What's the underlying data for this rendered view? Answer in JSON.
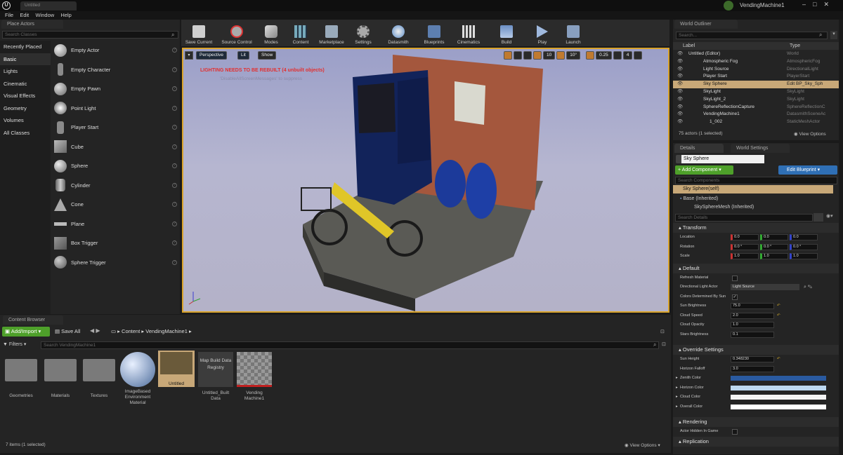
{
  "window": {
    "tab_title": "Untitled",
    "project_name": "VendingMachine1"
  },
  "menu": [
    "File",
    "Edit",
    "Window",
    "Help"
  ],
  "place_actors": {
    "tab": "Place Actors",
    "search_placeholder": "Search Classes",
    "categories": [
      "Recently Placed",
      "Basic",
      "Lights",
      "Cinematic",
      "Visual Effects",
      "Geometry",
      "Volumes",
      "All Classes"
    ],
    "selected_category": "Basic",
    "actors": [
      "Empty Actor",
      "Empty Character",
      "Empty Pawn",
      "Point Light",
      "Player Start",
      "Cube",
      "Sphere",
      "Cylinder",
      "Cone",
      "Plane",
      "Box Trigger",
      "Sphere Trigger"
    ]
  },
  "toolbar": [
    "Save Current",
    "Source Control",
    "Modes",
    "Content",
    "Marketplace",
    "Settings",
    "Datasmith",
    "Blueprints",
    "Cinematics",
    "Build",
    "Play",
    "Launch"
  ],
  "viewport": {
    "perspective": "Perspective",
    "lit": "Lit",
    "show": "Show",
    "warning": "LIGHTING NEEDS TO BE REBUILT (4 unbuilt objects)",
    "hint": "'DisableAllScreenMessages' to suppress",
    "grid": "10",
    "angle": "10°",
    "scale": "0.25",
    "cam": "4"
  },
  "outliner": {
    "tab": "World Outliner",
    "search_placeholder": "Search...",
    "col_label": "Label",
    "col_type": "Type",
    "rows": [
      {
        "name": "Untitled (Editor)",
        "type": "World"
      },
      {
        "name": "Atmospheric Fog",
        "type": "AtmosphericFog"
      },
      {
        "name": "Light Source",
        "type": "DirectionalLight"
      },
      {
        "name": "Player Start",
        "type": "PlayerStart"
      },
      {
        "name": "Sky Sphere",
        "type": "Edit BP_Sky_Sph"
      },
      {
        "name": "SkyLight",
        "type": "SkyLight"
      },
      {
        "name": "SkyLight_2",
        "type": "SkyLight"
      },
      {
        "name": "SphereReflectionCapture",
        "type": "SphereReflectionC"
      },
      {
        "name": "VendingMachine1",
        "type": "DatasmithSceneAc"
      },
      {
        "name": "1_002",
        "type": "StaticMeshActor"
      }
    ],
    "status": "75 actors (1 selected)",
    "view_options": "View Options"
  },
  "details": {
    "tab": "Details",
    "tab2": "World Settings",
    "name": "Sky Sphere",
    "add_component": "+ Add Component",
    "edit_blueprint": "Edit Blueprint",
    "search_components": "Search Components",
    "self": "Sky Sphere(self)",
    "base": "Base (Inherited)",
    "mesh": "SkySphereMesh (Inherited)",
    "search_details": "Search Details",
    "transform": "Transform",
    "location": "Location",
    "rotation": "Rotation",
    "scale": "Scale",
    "loc": [
      "0.0",
      "0.0",
      "0.0"
    ],
    "rot": [
      "0.0 °",
      "0.0 °",
      "0.0 °"
    ],
    "scl": [
      "1.0",
      "1.0",
      "1.0"
    ],
    "default": "Default",
    "refresh": "Refresh Material",
    "dla": "Directional Light Actor",
    "dla_value": "Light Source",
    "colors_by_sun": "Colors Determined By Sun",
    "sun_brightness": "Sun Brightness",
    "sun_brightness_v": "75.0",
    "cloud_speed": "Cloud Speed",
    "cloud_speed_v": "2.0",
    "cloud_opacity": "Cloud Opacity",
    "cloud_opacity_v": "1.0",
    "stars": "Stars Brightness",
    "stars_v": "0.1",
    "override": "Override Settings",
    "sun_height": "Sun Height",
    "sun_height_v": "0.348230",
    "horizon_falloff": "Horizon Falloff",
    "horizon_falloff_v": "3.0",
    "zenith": "Zenith Color",
    "horizon": "Horizon Color",
    "cloud_color": "Cloud Color",
    "overall": "Overall Color",
    "rendering": "Rendering",
    "hidden": "Actor Hidden In Game",
    "replication": "Replication"
  },
  "content_browser": {
    "tab": "Content Browser",
    "add": "Add/Import",
    "save_all": "Save All",
    "path": [
      "Content",
      "VendingMachine1"
    ],
    "filters": "Filters",
    "search_placeholder": "Search VendingMachine1",
    "assets": [
      "Geometries",
      "Materials",
      "Textures",
      "ImageBased Environment Material",
      "Untitled",
      "Untitled_Built Data",
      "Vending Machine1"
    ],
    "map_build": "Map Build Data Registry",
    "status": "7 items (1 selected)",
    "view_options": "View Options"
  },
  "colors": {
    "accent": "#4ea02a",
    "selection": "#c8a878",
    "blue_button": "#2f6fb5",
    "warning": "#e23030"
  }
}
